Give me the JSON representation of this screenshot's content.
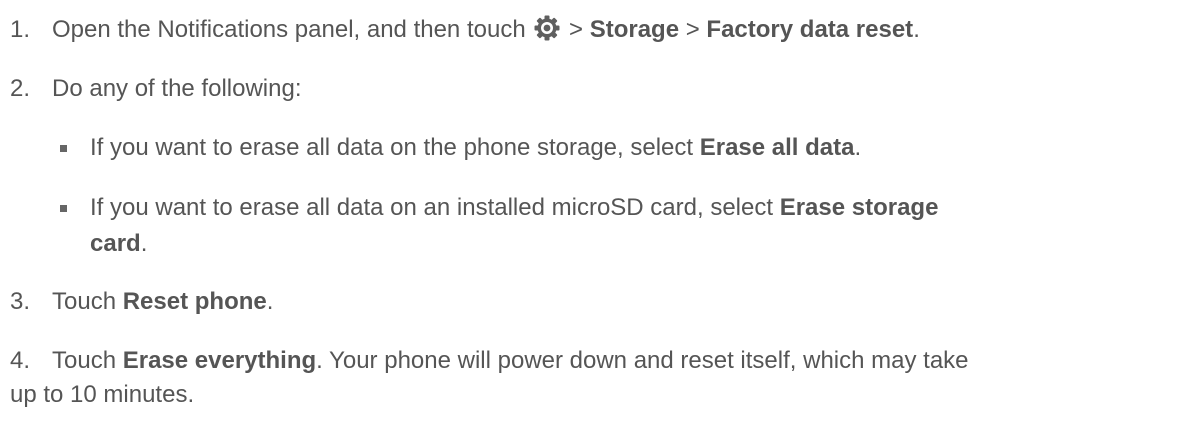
{
  "steps": [
    {
      "num": "1.",
      "pre": "Open the Notifications panel, and then touch",
      "icon": "settings-gear-icon",
      "sep1": ">",
      "bold1": "Storage",
      "sep2": ">",
      "bold2": "Factory data reset",
      "post": "."
    },
    {
      "num": "2.",
      "text": "Do any of the following:"
    },
    {
      "num": "3.",
      "pre": "Touch",
      "bold": "Reset phone",
      "post": "."
    },
    {
      "num": "4.",
      "pre": "Touch",
      "bold": "Erase everything",
      "post_line1": ". Your phone will power down and reset itself, which may take",
      "post_line2": "up to 10 minutes."
    }
  ],
  "bullets": [
    {
      "pre": "If you want to erase all data on the phone storage, select",
      "bold": "Erase all data",
      "post": "."
    },
    {
      "pre": "If you want to erase all data on an installed microSD card, select",
      "bold_line1": "Erase storage",
      "bold_line2": "card",
      "post": "."
    }
  ]
}
